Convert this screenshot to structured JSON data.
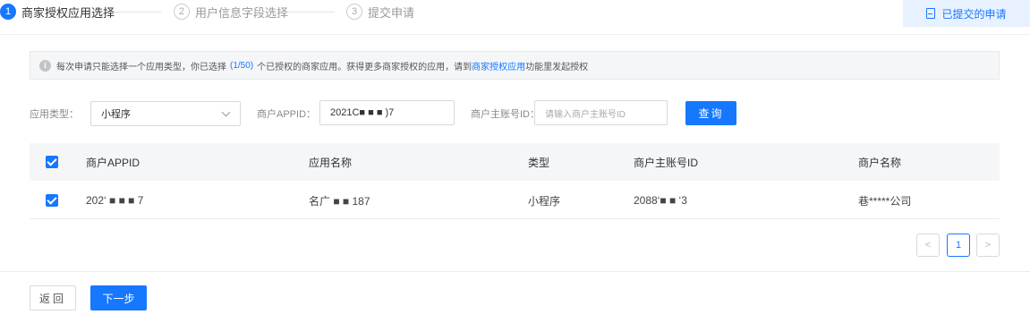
{
  "steps": [
    {
      "num": "1",
      "label": "商家授权应用选择"
    },
    {
      "num": "2",
      "label": "用户信息字段选择"
    },
    {
      "num": "3",
      "label": "提交申请"
    }
  ],
  "submitted_button": {
    "label": "已提交的申请",
    "icon": "document-icon"
  },
  "notice": {
    "prefix": "每次申请只能选择一个应用类型，你已选择",
    "count": "(1/50)",
    "middle": "个已授权的商家应用。获得更多商家授权的应用，请到",
    "link": "商家授权应用",
    "suffix": "功能里发起授权"
  },
  "filters": {
    "app_type_label": "应用类型：",
    "app_type_value": "小程序",
    "appid_label": "商户APPID：",
    "appid_value": "2021C■ ■ ■ )7",
    "main_account_label": "商户主账号ID：",
    "main_account_placeholder": "请输入商户主账号ID",
    "query_button": "查询"
  },
  "table": {
    "headers": [
      "商户APPID",
      "应用名称",
      "类型",
      "商户主账号ID",
      "商户名称"
    ],
    "rows": [
      {
        "appid": "202‘ ■ ■ ■ 7",
        "name": "名广 ■ ■ 187",
        "type": "小程序",
        "main_account": "2088‘■ ■ ‘3",
        "merchant": "巷*****公司"
      }
    ]
  },
  "pagination": {
    "prev": "<",
    "current": "1",
    "next": ">"
  },
  "footer": {
    "back_button": "返回",
    "next_button": "下一步"
  },
  "colors": {
    "accent": "#1677ff",
    "notice_bg": "#f5f6f8"
  }
}
